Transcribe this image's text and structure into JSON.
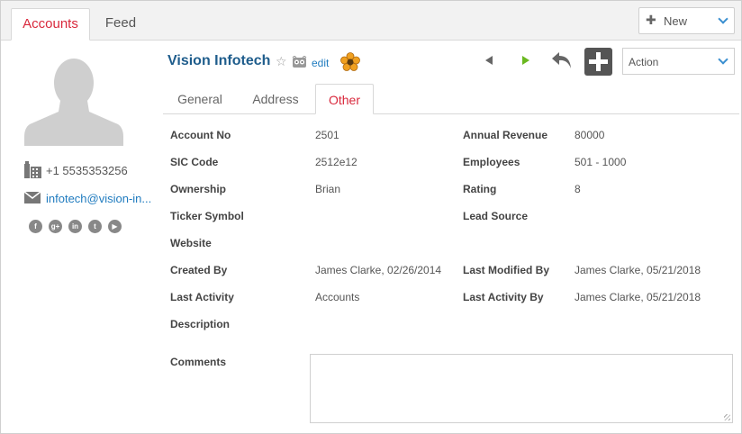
{
  "top_tabs": [
    {
      "label": "Accounts",
      "active": true
    },
    {
      "label": "Feed",
      "active": false
    }
  ],
  "new_button": {
    "label": "New",
    "icon": "plus-icon"
  },
  "contact": {
    "phone": "+1 5535353256",
    "email": "infotech@vision-in..."
  },
  "social": [
    "facebook-icon",
    "google-plus-icon",
    "linkedin-icon",
    "twitter-icon",
    "youtube-icon"
  ],
  "header": {
    "account_name": "Vision Infotech",
    "edit_label": "edit",
    "action_select": "Action"
  },
  "sub_tabs": [
    {
      "label": "General",
      "active": false
    },
    {
      "label": "Address",
      "active": false
    },
    {
      "label": "Other",
      "active": true
    }
  ],
  "fields_left": [
    {
      "label": "Account No",
      "value": "2501"
    },
    {
      "label": "SIC Code",
      "value": "2512e12"
    },
    {
      "label": "Ownership",
      "value": "Brian"
    },
    {
      "label": "Ticker Symbol",
      "value": ""
    },
    {
      "label": "Website",
      "value": ""
    },
    {
      "label": "Created By",
      "value": "James Clarke, 02/26/2014"
    },
    {
      "label": "Last Activity",
      "value": "Accounts"
    },
    {
      "label": "Description",
      "value": ""
    }
  ],
  "fields_right": [
    {
      "label": "Annual Revenue",
      "value": "80000"
    },
    {
      "label": "Employees",
      "value": "501 - 1000"
    },
    {
      "label": "Rating",
      "value": "8"
    },
    {
      "label": "Lead Source",
      "value": ""
    },
    {
      "label": "Last Modified By",
      "value": "James Clarke, 05/21/2018"
    },
    {
      "label": "Last Activity By",
      "value": "James Clarke, 05/21/2018"
    }
  ],
  "comments_label": "Comments",
  "colors": {
    "accent": "#d9283c",
    "link": "#1f5d8c",
    "next_arrow": "#6ab820"
  }
}
